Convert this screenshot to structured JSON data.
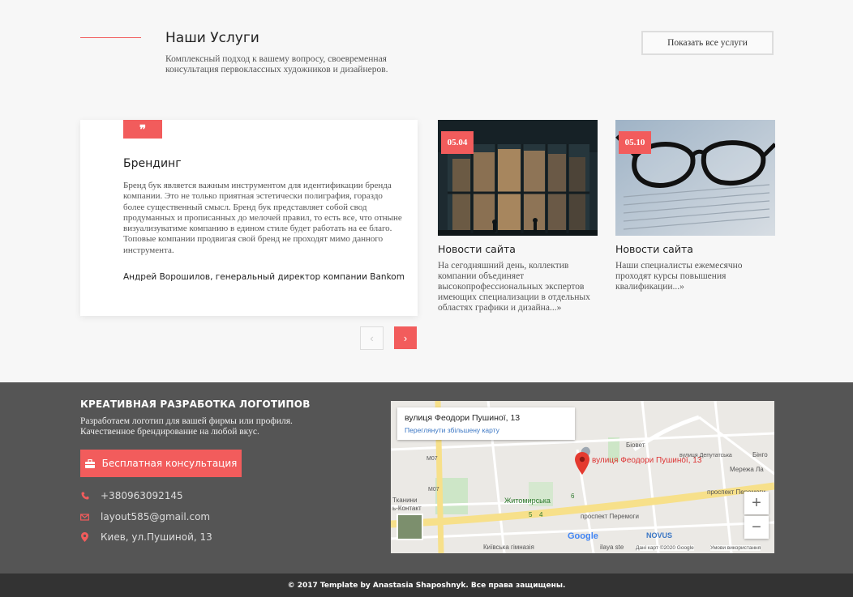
{
  "services": {
    "title": "Наши Услуги",
    "description": "Комплексный подход к вашему вопросу, своевременная консультация первоклассных художников и дизайнеров.",
    "show_all_label": "Показать все услуги"
  },
  "testimonial": {
    "quote_glyph": "❞",
    "title": "Брендинг",
    "text": "Бренд бук является важным инструментом для идентификации бренда компании. Это не только приятная эстетически полиграфия, гораздо более существенный смысл. Бренд бук представляет собой свод продуманных и прописанных до мелочей правил, то есть все, что отныне визуализуватиме компанию в едином стиле будет работать на ее благо. Топовые компании продвигая свой бренд не проходят мимо данного инструмента.",
    "author": "Андрей Ворошилов, генеральный директор компании Bankom"
  },
  "carousel": {
    "prev_glyph": "‹",
    "next_glyph": "›"
  },
  "news": [
    {
      "date": "05.04",
      "title": "Новости сайта",
      "text": "На сегодняшний день, коллектив компании объединяет высокопрофессиональных экспертов имеющих специализации в отдельных областях графики и дизайна...»"
    },
    {
      "date": "05.10",
      "title": "Новости сайта",
      "text": "Наши специалисты ежемесячно проходят курсы повышения квалификации...»"
    }
  ],
  "footer": {
    "title": "КРЕАТИВНАЯ РАЗРАБОТКА ЛОГОТИПОВ",
    "description": "Разработаем логотип для вашей фирмы или профиля. Качественное брендирование на любой вкус.",
    "consult_label": "Бесплатная консультация",
    "phone": "+380963092145",
    "email": "layout585@gmail.com",
    "address": "Киев, ул.Пушиной, 13"
  },
  "map": {
    "card_title": "вулиця Феодори Пушиної, 13",
    "card_link": "Переглянути збільшену карту",
    "marker_label": "вулиця Феодори Пушиної, 13",
    "zoom_in": "+",
    "zoom_out": "−",
    "labels": {
      "metro": "Житомирська",
      "avenue": "проспект Перемоги",
      "avenue2": "проспект Перемоги",
      "novus": "NOVUS",
      "google": "Google",
      "school": "Київська гімназія",
      "tkanini": "Тканини",
      "kontakt": "ь-Контакт",
      "meregha": "Мережа Ла",
      "bingo": "Бінго",
      "biovet": "Біовет",
      "m07a": "M07",
      "m07b": "M07",
      "street_deputatska": "вулиця Депутатська",
      "ilaya": "ilaya ste",
      "five": "5",
      "four": "4",
      "six": "6",
      "credits": "Дані карт ©2020 Google",
      "terms": "Умови використання"
    }
  },
  "copyright": "© 2017 Template by Anastasia Shaposhnyk. Все права защищены.",
  "colors": {
    "accent": "#f25c5c",
    "footer_bg": "#555555",
    "copyright_bg": "#333333"
  }
}
